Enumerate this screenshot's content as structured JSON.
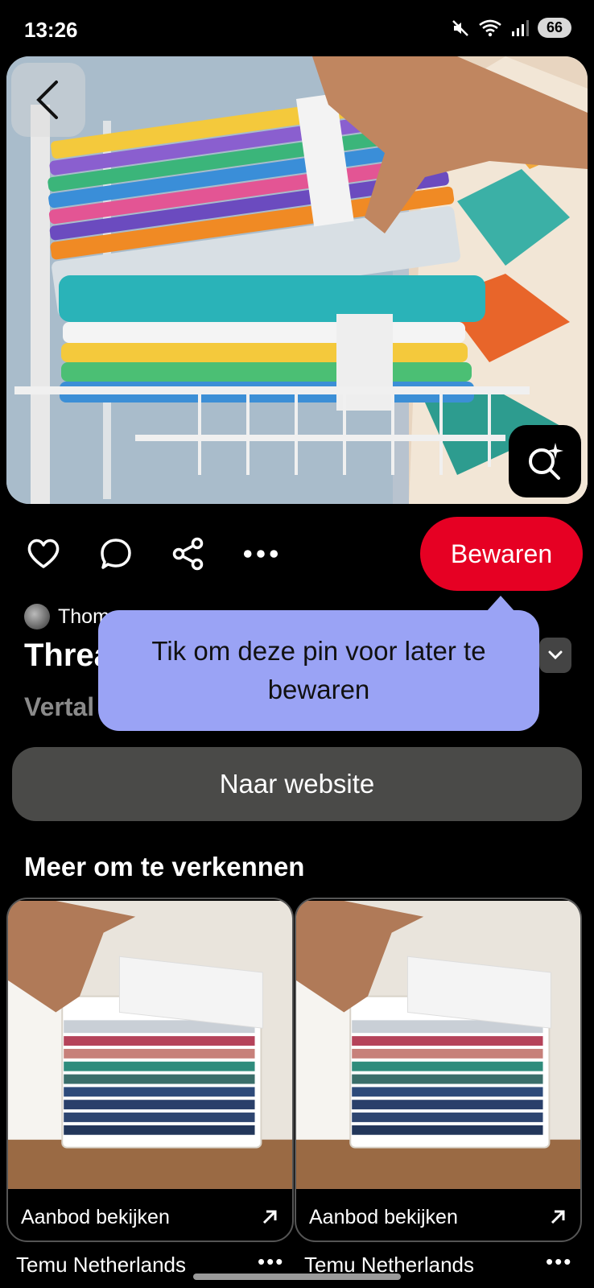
{
  "status_bar": {
    "time": "13:26",
    "battery": "66"
  },
  "pin": {
    "author": "Thom",
    "title_visible": "Threa",
    "translate_label": "Vertal"
  },
  "actions": {
    "save_label": "Bewaren"
  },
  "tooltip": {
    "text": "Tik om deze pin voor later te bewaren"
  },
  "website_button": "Naar website",
  "more_section": {
    "title": "Meer om te verkennen",
    "cards": [
      {
        "label": "Aanbod bekijken",
        "source": "Temu Netherlands"
      },
      {
        "label": "Aanbod bekijken",
        "source": "Temu Netherlands"
      }
    ]
  },
  "colors": {
    "save": "#e60023",
    "tooltip": "#9aa3f5",
    "website_button": "#4a4a48"
  }
}
